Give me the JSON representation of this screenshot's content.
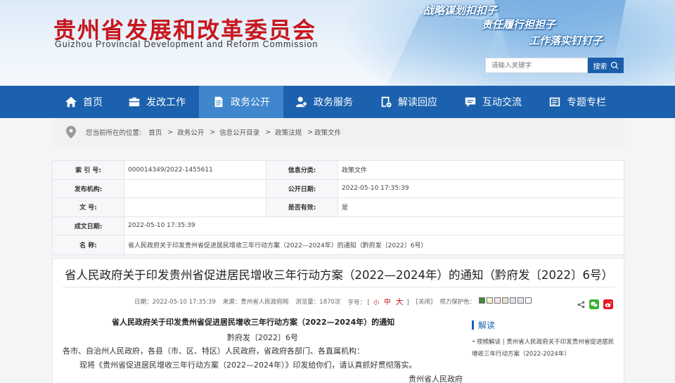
{
  "header": {
    "title": "贵州省发展和改革委员会",
    "subtitle": "Guizhou Provincial Development and Reform Commission",
    "slogans": [
      "战略谋划扣扣子",
      "责任履行担担子",
      "工作落实钉钉子"
    ],
    "search_placeholder": "请输入关键字",
    "search_label": "搜索"
  },
  "nav": {
    "items": [
      {
        "label": "首页",
        "icon": "home-icon"
      },
      {
        "label": "发改工作",
        "icon": "briefcase-icon"
      },
      {
        "label": "政务公开",
        "icon": "document-icon"
      },
      {
        "label": "政务服务",
        "icon": "user-service-icon"
      },
      {
        "label": "解读回应",
        "icon": "interpret-icon"
      },
      {
        "label": "互动交流",
        "icon": "chat-icon"
      },
      {
        "label": "专题专栏",
        "icon": "column-icon"
      }
    ],
    "active": "政务公开"
  },
  "breadcrumb": {
    "prefix": "您当前所在的位置:",
    "items": [
      "首页",
      "政务公开",
      "信息公开目录",
      "政策法规",
      "政策文件"
    ],
    "sep": ">"
  },
  "info": {
    "index_label": "索 引 号:",
    "index_value": "000014349/2022-1455611",
    "category_label": "信息分类:",
    "category_value": "政策文件",
    "issuer_label": "发布机构:",
    "issuer_value": "",
    "pubdate_label": "公开日期:",
    "pubdate_value": "2022-05-10 17:35:39",
    "docnum_label": "文 号:",
    "docnum_value": "",
    "valid_label": "是否有效:",
    "valid_value": "是",
    "created_label": "成文日期:",
    "created_value": "2022-05-10 17:35:39",
    "name_label": "名 称:",
    "name_value": "省人民政府关于印发贵州省促进居民增收三年行动方案（2022—2024年）的通知（黔府发〔2022〕6号）"
  },
  "article": {
    "title": "省人民政府关于印发贵州省促进居民增收三年行动方案（2022—2024年）的通知（黔府发〔2022〕6号）",
    "meta_date": "日期：2022-05-10 17:35:39",
    "meta_source": "来源：贵州省人民政府网",
    "meta_views": "浏览量：1870次",
    "meta_font": "字号：",
    "font_open": "[",
    "font_small": "小",
    "font_medium": "中",
    "font_large": "大",
    "font_close": "]",
    "meta_close": "[关闭]",
    "meta_eye": "视力保护色：",
    "swatch_colors": [
      "#3c8a3c",
      "#f2f2d6",
      "#f6e7e4",
      "#e9e1d3",
      "#dfe4ee",
      "#e7e3f1",
      "#ffffff"
    ],
    "doc_title": "省人民政府关于印发贵州省促进居民增收三年行动方案（2022—2024年）的通知",
    "doc_num": "黔府发〔2022〕6号",
    "doc_to": "各市、自治州人民政府，各县（市、区、特区）人民政府，省政府各部门、各直属机构：",
    "doc_body": "现将《贵州省促进居民增收三年行动方案（2022—2024年）》印发给你们，请认真抓好贯彻落实。",
    "doc_sign": "贵州省人民政府"
  },
  "side": {
    "heading": "解读",
    "item": "视频解读 | 贵州省人民政府关于印发贵州省促进居民增收三年行动方案（2022-2024年）"
  },
  "colors": {
    "brand_red": "#c8161d",
    "nav_blue": "#1b61ae",
    "nav_active": "#3f86cc"
  }
}
